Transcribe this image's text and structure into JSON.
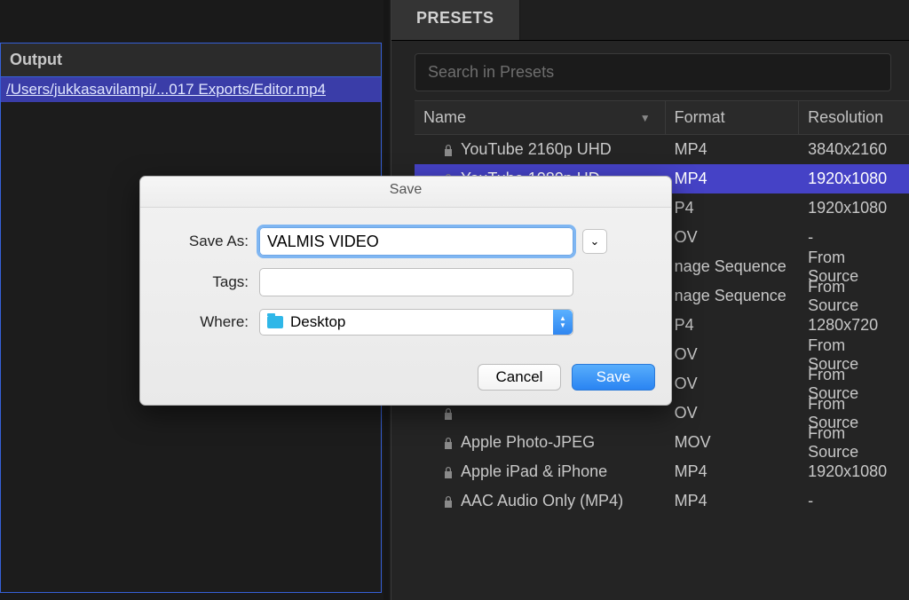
{
  "output": {
    "header": "Output",
    "path": "/Users/jukkasavilampi/...017 Exports/Editor.mp4"
  },
  "tabs": {
    "presets": "PRESETS"
  },
  "search": {
    "placeholder": "Search in Presets"
  },
  "columns": {
    "name": "Name",
    "format": "Format",
    "resolution": "Resolution"
  },
  "presets": [
    {
      "check": "",
      "name": "YouTube 2160p UHD",
      "format": "MP4",
      "res": "3840x2160",
      "selected": false
    },
    {
      "check": "✓",
      "name": "YouTube 1080p HD",
      "format": "MP4",
      "res": "1920x1080",
      "selected": true
    },
    {
      "check": "",
      "name": "",
      "format": "P4",
      "res": "1920x1080",
      "selected": false
    },
    {
      "check": "",
      "name": "",
      "format": "OV",
      "res": "-",
      "selected": false
    },
    {
      "check": "",
      "name": "",
      "format": "nage Sequence",
      "res": "From Source",
      "selected": false
    },
    {
      "check": "",
      "name": "",
      "format": "nage Sequence",
      "res": "From Source",
      "selected": false
    },
    {
      "check": "",
      "name": "",
      "format": "P4",
      "res": "1280x720",
      "selected": false
    },
    {
      "check": "",
      "name": "",
      "format": "OV",
      "res": "From Source",
      "selected": false
    },
    {
      "check": "",
      "name": "",
      "format": "OV",
      "res": "From Source",
      "selected": false
    },
    {
      "check": "",
      "name": "",
      "format": "OV",
      "res": "From Source",
      "selected": false
    },
    {
      "check": "",
      "name": "Apple Photo-JPEG",
      "format": "MOV",
      "res": "From Source",
      "selected": false
    },
    {
      "check": "",
      "name": "Apple iPad & iPhone",
      "format": "MP4",
      "res": "1920x1080",
      "selected": false
    },
    {
      "check": "",
      "name": "AAC Audio Only (MP4)",
      "format": "MP4",
      "res": "-",
      "selected": false
    }
  ],
  "dialog": {
    "title": "Save",
    "saveAsLabel": "Save As:",
    "saveAsValue": "VALMIS VIDEO",
    "tagsLabel": "Tags:",
    "tagsValue": "",
    "whereLabel": "Where:",
    "whereValue": "Desktop",
    "cancel": "Cancel",
    "save": "Save"
  }
}
